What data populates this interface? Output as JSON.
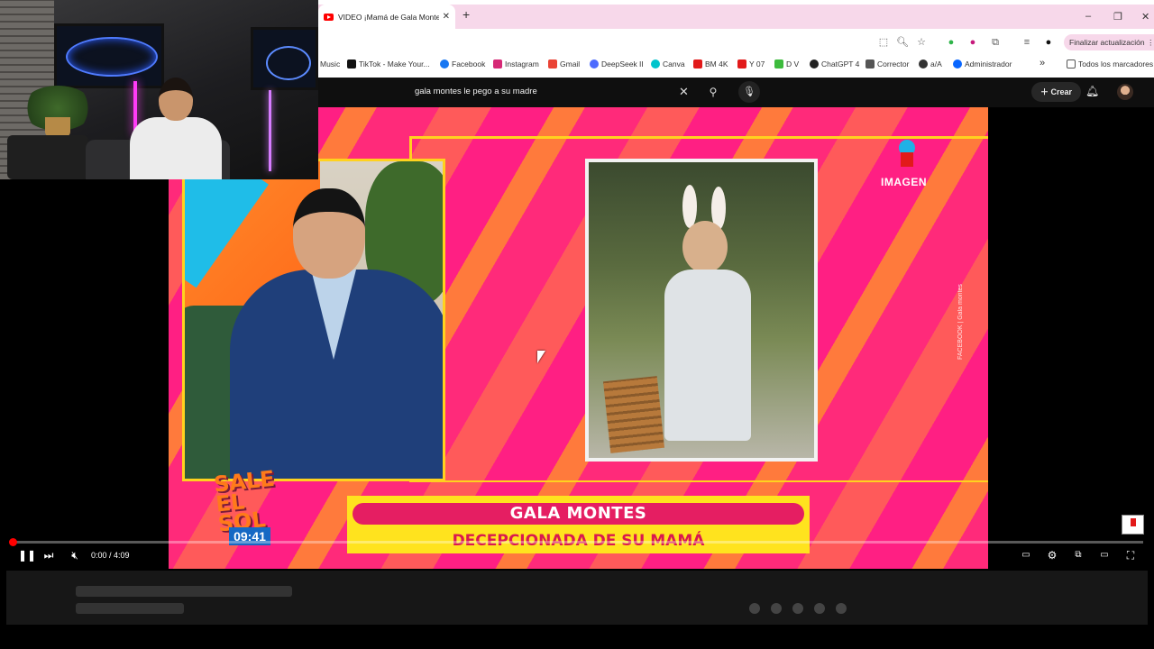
{
  "browser": {
    "tab_title": "VIDEO ¡Mamá de Gala Montes",
    "tab_close": "✕",
    "new_tab": "+",
    "window_controls": [
      "–",
      "❐",
      "✕"
    ],
    "update_button": "Finalizar actualización",
    "bookmarks": [
      {
        "label": "Music",
        "icon": "music",
        "color": "#ffffff"
      },
      {
        "label": "TikTok - Make Your...",
        "icon": "tiktok-icon",
        "color": "#111111"
      },
      {
        "label": "Facebook",
        "icon": "facebook-icon",
        "color": "#1877f2"
      },
      {
        "label": "Instagram",
        "icon": "instagram-icon",
        "color": "#d62976"
      },
      {
        "label": "Gmail",
        "icon": "gmail-icon",
        "color": "#ea4335"
      },
      {
        "label": "DeepSeek II",
        "icon": "deepseek-icon",
        "color": "#4d6bfe"
      },
      {
        "label": "Canva",
        "icon": "canva-icon",
        "color": "#00c4cc"
      },
      {
        "label": "BM 4K",
        "icon": "bm-icon",
        "color": "#e21a1a"
      },
      {
        "label": "Y 07",
        "icon": "youtube-icon",
        "color": "#e21a1a"
      },
      {
        "label": "D V",
        "icon": "download-icon",
        "color": "#3dbb3d"
      },
      {
        "label": "ChatGPT 4",
        "icon": "chatgpt-icon",
        "color": "#222222"
      },
      {
        "label": "Corrector",
        "icon": "corrector-icon",
        "color": "#555555"
      },
      {
        "label": "a/A",
        "icon": "globe-icon",
        "color": "#333333"
      },
      {
        "label": "Administrador",
        "icon": "meta-icon",
        "color": "#0866ff"
      }
    ],
    "bookmarks_more": "»",
    "all_bookmarks": "Todos los marcadores"
  },
  "youtube": {
    "search_query": "gala montes le pego a su madre",
    "create_label": "Crear"
  },
  "video": {
    "lower_third_title": "GALA MONTES",
    "lower_third_subtitle": "DECEPCIONADA DE SU MAMÁ",
    "show_logo": "SALE EL SOL",
    "clock": "09:41",
    "network": "IMAGEN",
    "credit": "FACEBOOK | Gala montes"
  },
  "player": {
    "time": "0:00 / 4:09",
    "progress_fraction": 0.0
  },
  "colors": {
    "accent_red": "#ff0000",
    "tab_strip": "#f7d8ea",
    "yt_dark": "#0f0f0f"
  }
}
